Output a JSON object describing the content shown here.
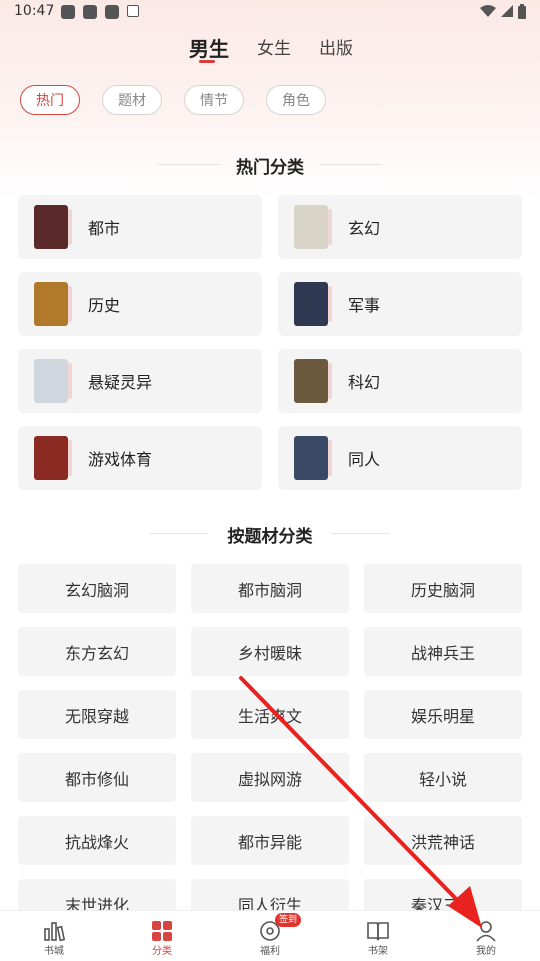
{
  "status_bar": {
    "time": "10:47"
  },
  "top_tabs": [
    {
      "label": "男生",
      "active": true
    },
    {
      "label": "女生",
      "active": false
    },
    {
      "label": "出版",
      "active": false
    }
  ],
  "filter_chips": [
    {
      "label": "热门",
      "active": true
    },
    {
      "label": "题材",
      "active": false
    },
    {
      "label": "情节",
      "active": false
    },
    {
      "label": "角色",
      "active": false
    }
  ],
  "hot_section": {
    "title": "热门分类",
    "categories": [
      {
        "label": "都市",
        "cover_color": "#5a2a2a"
      },
      {
        "label": "玄幻",
        "cover_color": "#d9d4c8"
      },
      {
        "label": "历史",
        "cover_color": "#b07a2a"
      },
      {
        "label": "军事",
        "cover_color": "#2f3a52"
      },
      {
        "label": "悬疑灵异",
        "cover_color": "#cfd6de"
      },
      {
        "label": "科幻",
        "cover_color": "#6b5a3e"
      },
      {
        "label": "游戏体育",
        "cover_color": "#8a2a22"
      },
      {
        "label": "同人",
        "cover_color": "#3a4a66"
      }
    ]
  },
  "theme_section": {
    "title": "按题材分类",
    "themes": [
      "玄幻脑洞",
      "都市脑洞",
      "历史脑洞",
      "东方玄幻",
      "乡村暖昧",
      "战神兵王",
      "无限穿越",
      "生活爽文",
      "娱乐明星",
      "都市修仙",
      "虚拟网游",
      "轻小说",
      "抗战烽火",
      "都市异能",
      "洪荒神话",
      "末世进化",
      "同人衍生",
      "秦汉三国"
    ]
  },
  "bottom_nav": [
    {
      "label": "书城",
      "icon": "bar-chart-icon",
      "active": false
    },
    {
      "label": "分类",
      "icon": "grid-icon",
      "active": true
    },
    {
      "label": "福利",
      "icon": "disc-icon",
      "active": false,
      "badge": "签到"
    },
    {
      "label": "书架",
      "icon": "book-icon",
      "active": false
    },
    {
      "label": "我的",
      "icon": "user-icon",
      "active": false
    }
  ],
  "colors": {
    "accent": "#d6453f",
    "card_bg": "#f4f4f5",
    "annotation_arrow": "#e8221f"
  }
}
